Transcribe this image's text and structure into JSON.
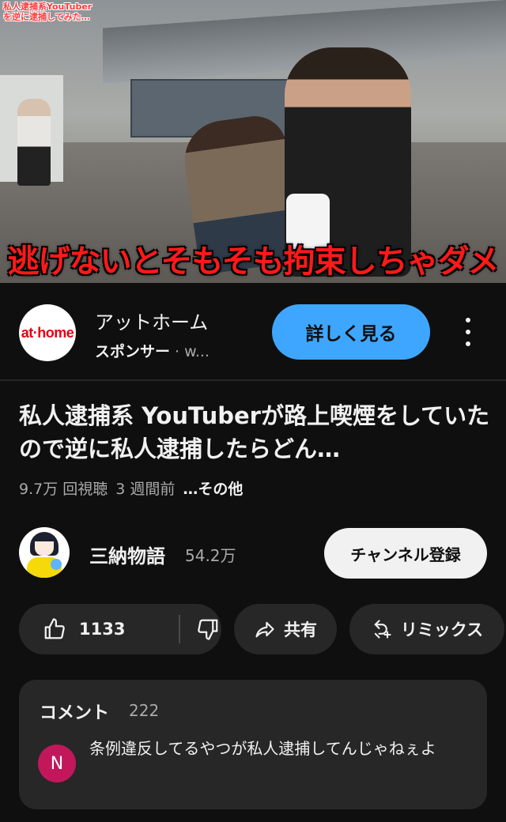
{
  "video": {
    "overlay_small": "私人逮捕系YouTuber\nを逆に逮捕してみた…",
    "overlay_large": "逃げないとそもそも拘束しちゃダメ"
  },
  "ad": {
    "logo_text": "at·home",
    "advertiser": "アットホーム",
    "sponsor_label": "スポンサー",
    "url_preview": "w...",
    "cta_label": "詳しく見る"
  },
  "video_info": {
    "title": "私人逮捕系 YouTuberが路上喫煙をしていたので逆に私人逮捕したらどん…",
    "views": "9.7万 回視聴",
    "age": "3 週間前",
    "more": "…その他"
  },
  "channel": {
    "name": "三納物語",
    "subscribers": "54.2万",
    "subscribe_label": "チャンネル登録"
  },
  "actions": {
    "like_count": "1133",
    "share_label": "共有",
    "remix_label": "リミックス"
  },
  "comments": {
    "header": "コメント",
    "count": "222",
    "top_comment": {
      "avatar_letter": "N",
      "avatar_color": "#c2185b",
      "text": "条例違反してるやつが私人逮捕してんじゃねぇよ"
    }
  },
  "colors": {
    "background": "#0f0f0f",
    "accent": "#3ea6ff",
    "caption_red": "#ff1a1a"
  }
}
